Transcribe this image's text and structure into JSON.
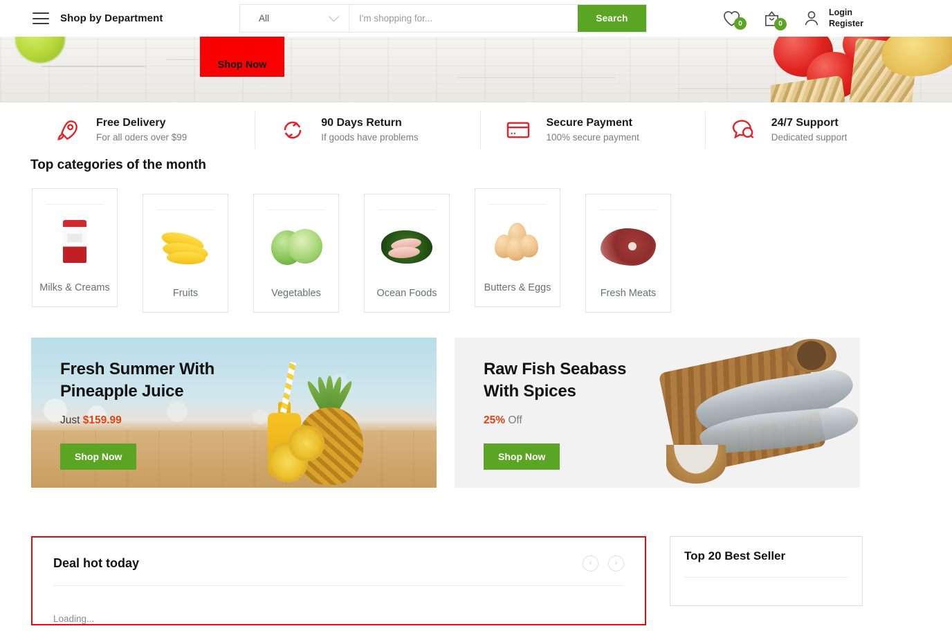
{
  "header": {
    "menu_icon": "hamburger-icon",
    "department_label": "Shop by Department",
    "search": {
      "category_value": "All",
      "category_icon": "chevron-down-icon",
      "placeholder": "I'm shopping for...",
      "input_value": "",
      "button_label": "Search"
    },
    "wishlist": {
      "icon": "heart-icon",
      "count": "0"
    },
    "cart": {
      "icon": "shopping-bag-icon",
      "count": "0"
    },
    "account": {
      "icon": "user-icon",
      "login_label": "Login",
      "register_label": "Register"
    }
  },
  "hero": {
    "shop_now_label": "Shop Now",
    "button_color": "#fa0000"
  },
  "features": [
    {
      "icon": "rocket-icon",
      "title": "Free Delivery",
      "subtitle": "For all oders over $99"
    },
    {
      "icon": "refresh-cycle-icon",
      "title": "90 Days Return",
      "subtitle": "If goods have problems"
    },
    {
      "icon": "credit-card-icon",
      "title": "Secure Payment",
      "subtitle": "100% secure payment"
    },
    {
      "icon": "chat-bubbles-icon",
      "title": "24/7 Support",
      "subtitle": "Dedicated support"
    }
  ],
  "categories": {
    "title": "Top categories of the month",
    "items": [
      {
        "name": "Milks & Creams",
        "image": "milk-carton-image"
      },
      {
        "name": "Fruits",
        "image": "bananas-image"
      },
      {
        "name": "Vegetables",
        "image": "cabbage-image"
      },
      {
        "name": "Ocean Foods",
        "image": "fish-slices-image"
      },
      {
        "name": "Butters & Eggs",
        "image": "eggs-image"
      },
      {
        "name": "Fresh Meats",
        "image": "raw-meat-image"
      }
    ]
  },
  "promos": [
    {
      "heading_line1": "Fresh Summer With",
      "heading_line2": "Pineapple Juice",
      "sub_prefix": "Just ",
      "sub_highlight": "$159.99",
      "sub_suffix": "",
      "button_label": "Shop Now"
    },
    {
      "heading_line1": "Raw Fish Seabass",
      "heading_line2": "With Spices",
      "sub_prefix": "",
      "sub_highlight": "25%",
      "sub_suffix": " Off",
      "button_label": "Shop Now"
    }
  ],
  "deal": {
    "title": "Deal hot today",
    "prev_icon": "chevron-left-icon",
    "next_icon": "chevron-right-icon",
    "prev_glyph": "‹",
    "next_glyph": "›",
    "loading_text": "Loading...",
    "border_color": "#e60a0a"
  },
  "best_seller": {
    "title": "Top 20 Best Seller"
  },
  "colors": {
    "accent_green": "#5ba524",
    "accent_red": "#e60a0a",
    "price_orange": "#e8400e"
  }
}
